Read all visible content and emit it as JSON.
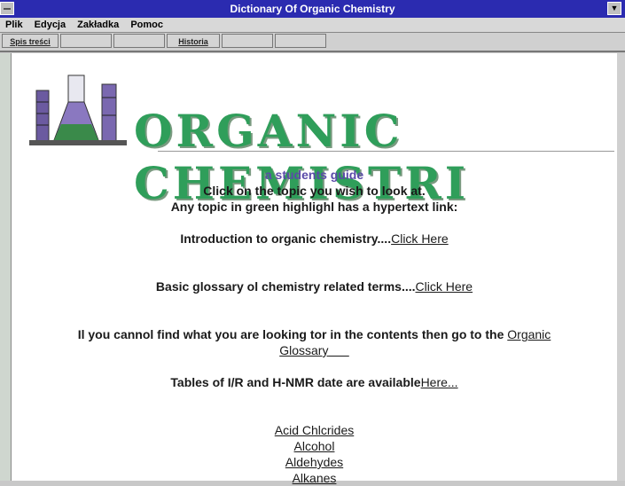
{
  "window": {
    "title": "Dictionary Of Organic Chemistry"
  },
  "menu": [
    "Plik",
    "Edycja",
    "Zakładka",
    "Pomoc"
  ],
  "toolbar": {
    "contents": "Spis treści",
    "history": "Historia"
  },
  "banner": {
    "title": "ORGANIC CHEMISTRI"
  },
  "content": {
    "subtitle": "a students guide",
    "line1": "Click on the topic you wish to look at.",
    "line2": "Any topic in green highlighl has a hypertext link:",
    "intro_text": "Introduction to organic chemistry....",
    "intro_link": "Click Here",
    "glossary_text": "Basic glossary ol chemistry related terms....",
    "glossary_link": "Click Here",
    "cannot_text": "Il you cannol find what you are looking tor in the contents then go to the",
    "organic_link": "Organic",
    "glossary_word": "Glossary",
    "tables_text": "Tables of I/R and H-NMR date are available",
    "here_link": "Here...",
    "topics": [
      "Acid Chlcrides",
      "Alcohol",
      "Aldehydes",
      "Alkanes"
    ]
  },
  "colors": {
    "titlebar": "#2b2bb0",
    "banner": "#2f9e5a",
    "subtitle": "#5a4aa8"
  }
}
